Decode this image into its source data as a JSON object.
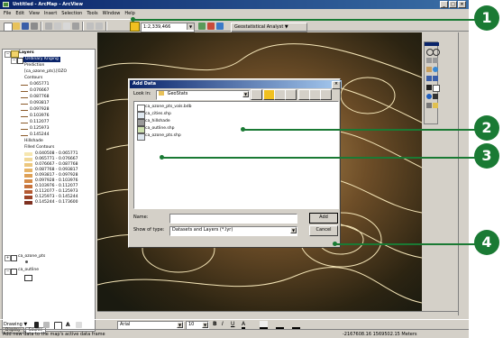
{
  "window": {
    "title": "Untitled - ArcMap - ArcView",
    "minimize": "_",
    "maximize": "□",
    "close": "×"
  },
  "menu": [
    "File",
    "Edit",
    "View",
    "Insert",
    "Selection",
    "Tools",
    "Window",
    "Help"
  ],
  "toolbar": {
    "scale_value": "1:2,339,466",
    "geostat_label": "Geostatistical Analyst ▼"
  },
  "toc": {
    "layers_label": "Layers",
    "kriging_label": "Ordinary Kriging",
    "rows": [
      {
        "label": "Prediction"
      },
      {
        "label": "[ca_ozone_pts].[OZO"
      },
      {
        "label": "Contours"
      },
      {
        "label": "0.065771"
      },
      {
        "label": "0.076667"
      },
      {
        "label": "0.087768"
      },
      {
        "label": "0.093817"
      },
      {
        "label": "0.097928"
      },
      {
        "label": "0.103976"
      },
      {
        "label": "0.112077"
      },
      {
        "label": "0.125973"
      },
      {
        "label": "0.145244"
      },
      {
        "label": "Hillshade"
      },
      {
        "label": "Filled Contours"
      }
    ],
    "filled": [
      {
        "label": "0.040508 - 0.065771",
        "color": "#f6e6b0"
      },
      {
        "label": "0.065771 - 0.076667",
        "color": "#f1d898"
      },
      {
        "label": "0.076667 - 0.087768",
        "color": "#ecc77e"
      },
      {
        "label": "0.087768 - 0.093817",
        "color": "#e6b468"
      },
      {
        "label": "0.093817 - 0.097928",
        "color": "#dea056"
      },
      {
        "label": "0.097928 - 0.103976",
        "color": "#d48a48"
      },
      {
        "label": "0.103976 - 0.112077",
        "color": "#c6723c"
      },
      {
        "label": "0.112077 - 0.125973",
        "color": "#b45a32"
      },
      {
        "label": "0.125973 - 0.145244",
        "color": "#9c4428"
      },
      {
        "label": "0.145244 - 0.173600",
        "color": "#7e3020"
      }
    ],
    "ozone_layer": "ca_ozone_pts",
    "outline_layer": "ca_outline",
    "tab_display": "Display",
    "tab_source": "Source"
  },
  "dialog": {
    "title": "Add Data",
    "close": "×",
    "lookin_label": "Look in:",
    "lookin_value": "GeoStats",
    "files": [
      {
        "name": "ca_ozone_pts_vals.bdb",
        "icon": "table"
      },
      {
        "name": "ca_cities.shp",
        "icon": "point"
      },
      {
        "name": "ca_hillshade",
        "icon": "raster"
      },
      {
        "name": "ca_outline.shp",
        "icon": "polygon"
      },
      {
        "name": "ca_ozone_pts.shp",
        "icon": "point"
      }
    ],
    "name_label": "Name:",
    "name_value": "",
    "type_label": "Show of type:",
    "type_value": "Datasets and Layers (*.lyr)",
    "add_button": "Add",
    "cancel_button": "Cancel"
  },
  "drawing": {
    "drawing_label": "Drawing ▼",
    "font_value": "Arial",
    "size_value": "10"
  },
  "status": {
    "message": "Add new data to the map's active data frame",
    "coords": "-2167608.16  1569502.15 Meters"
  },
  "callouts": [
    "1",
    "2",
    "3",
    "4"
  ],
  "colors": {
    "callout": "#1a7a34",
    "titlebar": "#0a246a"
  }
}
